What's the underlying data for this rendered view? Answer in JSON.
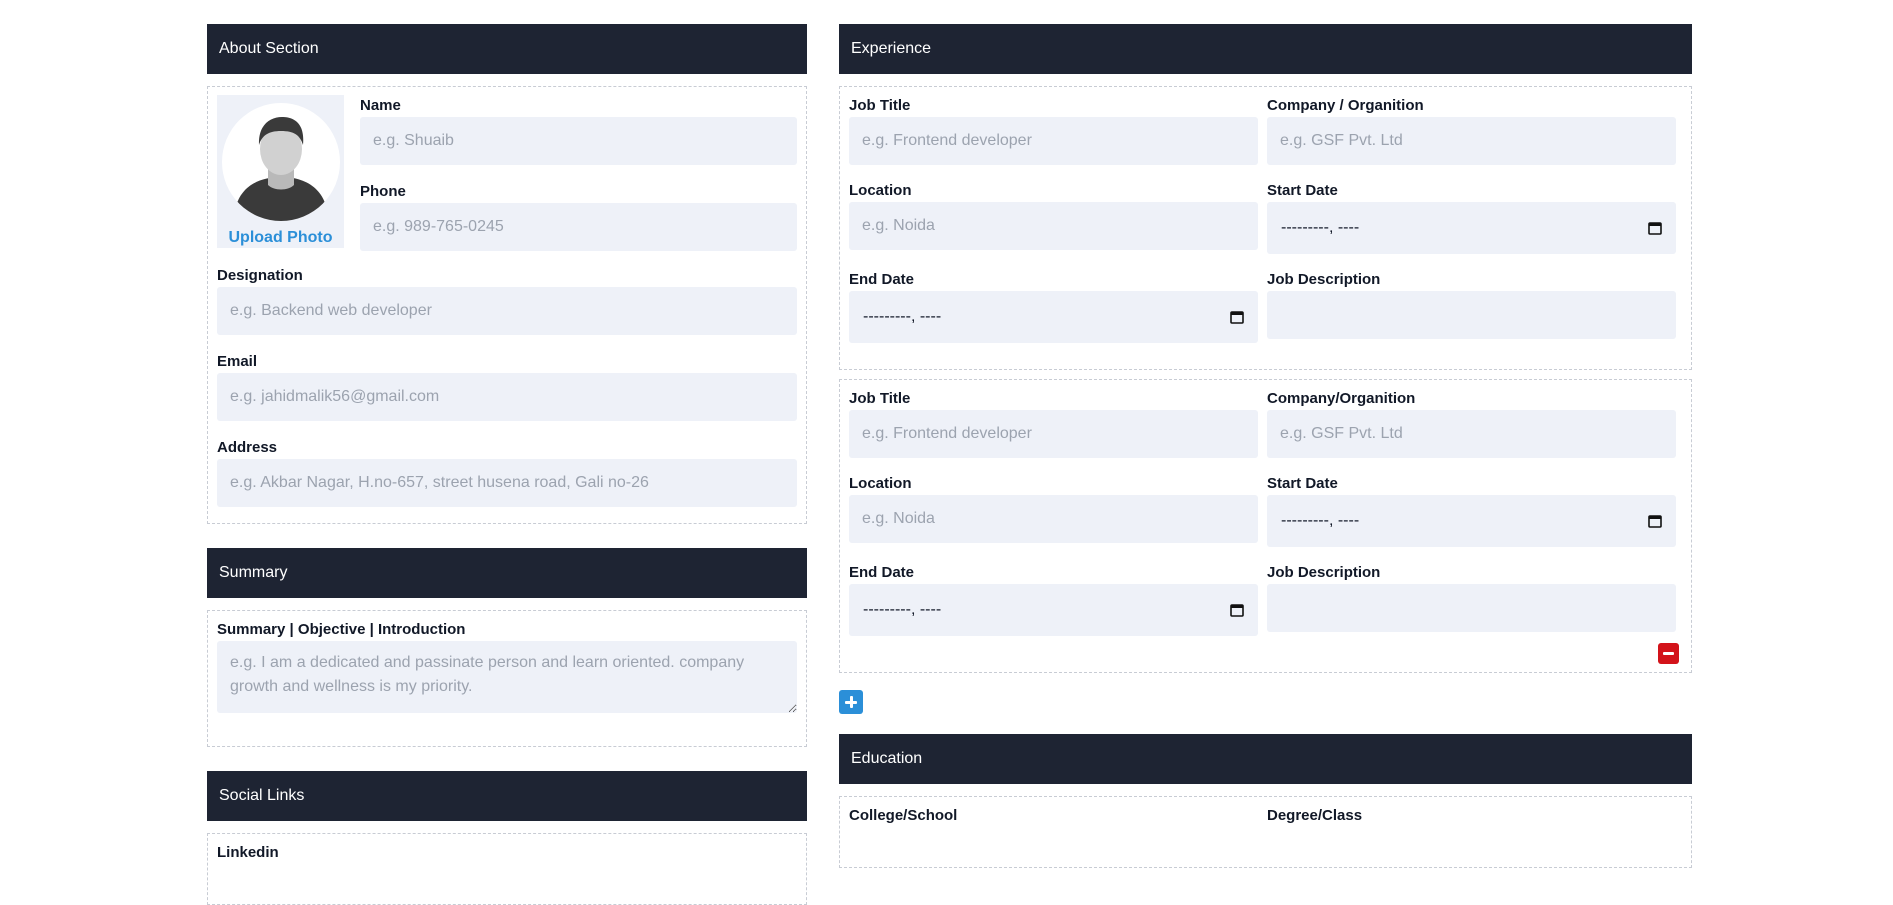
{
  "about": {
    "header": "About Section",
    "upload_label": "Upload Photo",
    "name": {
      "label": "Name",
      "placeholder": "e.g. Shuaib",
      "value": ""
    },
    "phone": {
      "label": "Phone",
      "placeholder": "e.g. 989-765-0245",
      "value": ""
    },
    "designation": {
      "label": "Designation",
      "placeholder": "e.g. Backend web developer",
      "value": ""
    },
    "email": {
      "label": "Email",
      "placeholder": "e.g. jahidmalik56@gmail.com",
      "value": ""
    },
    "address": {
      "label": "Address",
      "placeholder": "e.g. Akbar Nagar, H.no-657, street husena road, Gali no-26",
      "value": ""
    }
  },
  "summary": {
    "header": "Summary",
    "label": "Summary | Objective | Introduction",
    "placeholder": "e.g. I am a dedicated and passinate person and learn oriented. company growth and wellness is my priority.",
    "value": ""
  },
  "social": {
    "header": "Social Links",
    "linkedin_label": "Linkedin"
  },
  "experience": {
    "header": "Experience",
    "entries": [
      {
        "job_title_label": "Job Title",
        "job_title_placeholder": "e.g. Frontend developer",
        "company_label": "Company / Organition",
        "company_placeholder": "e.g. GSF Pvt. Ltd",
        "location_label": "Location",
        "location_placeholder": "e.g. Noida",
        "start_label": "Start Date",
        "start_value": "---------, ----",
        "end_label": "End Date",
        "end_value": "---------, ----",
        "desc_label": "Job Description",
        "desc_value": ""
      },
      {
        "job_title_label": "Job Title",
        "job_title_placeholder": "e.g. Frontend developer",
        "company_label": "Company/Organition",
        "company_placeholder": "e.g. GSF Pvt. Ltd",
        "location_label": "Location",
        "location_placeholder": "e.g. Noida",
        "start_label": "Start Date",
        "start_value": "---------, ----",
        "end_label": "End Date",
        "end_value": "---------, ----",
        "desc_label": "Job Description",
        "desc_value": ""
      }
    ]
  },
  "education": {
    "header": "Education",
    "college_label": "College/School",
    "degree_label": "Degree/Class"
  },
  "icons": {
    "avatar": "user-avatar-icon",
    "calendar": "calendar-icon",
    "remove": "minus-icon",
    "add": "plus-icon"
  },
  "colors": {
    "header_bg": "#1e2433",
    "field_bg": "#eef1f8",
    "accent": "#2b8fd8",
    "danger": "#d3131a"
  }
}
